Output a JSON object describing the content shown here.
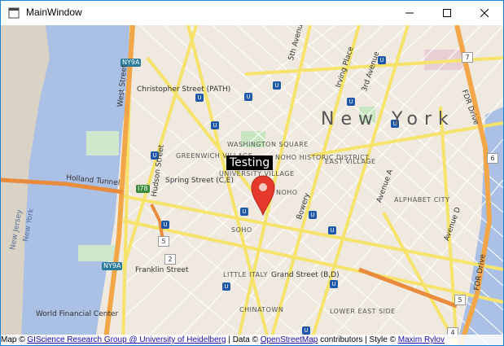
{
  "window": {
    "title": "MainWindow",
    "controls": {
      "minimize": "minimize",
      "maximize": "maximize",
      "close": "close"
    }
  },
  "map": {
    "marker_tooltip": "Testing",
    "city_label": "New York",
    "neighborhoods": {
      "washington_square": "WASHINGTON SQUARE",
      "greenwich_village": "GREENWICH VILLAGE",
      "university_village": "UNIVERSITY VILLAGE",
      "noho_historic": "NOHO HISTORIC DISTRICT",
      "noho": "NOHO",
      "east_village": "EAST VILLAGE",
      "alphabet_city": "ALPHABET CITY",
      "soho": "SOHO",
      "little_italy": "LITTLE ITALY",
      "chinatown": "CHINATOWN",
      "lower_east_side": "LOWER EAST SIDE",
      "world_financial_center": "World Financial Center"
    },
    "streets": {
      "west_street": "West Street",
      "fifth_avenue": "5th Avenue",
      "irving_place": "Irving Place",
      "third_avenue": "3rd Avenue",
      "fdr_drive_top": "FDR Drive",
      "fdr_drive_bottom": "FDR Drive",
      "holland_tunnel": "Holland Tunnel",
      "hudson_street": "Hudson Street",
      "spring_street": "Spring Street (C,E)",
      "christopher_street": "Christopher Street (PATH)",
      "avenue_a": "Avenue A",
      "avenue_d": "Avenue D",
      "bowery": "Bowery",
      "franklin_street": "Franklin Street",
      "grand_street": "Grand Street (B,D)",
      "new_jersey": "New Jersey",
      "new_york": "New York"
    },
    "shields": {
      "ny9a_top": "NY9A",
      "ny9a_bottom": "NY9A",
      "i78": "I78"
    },
    "routes": {
      "r7": "7",
      "r6": "6",
      "r5a": "5",
      "r2": "2",
      "r5b": "5",
      "r4": "4"
    },
    "subway_symbol": "U",
    "attribution": {
      "prefix": "Map ©",
      "gis_link": "GIScience Research Group @ University of Heidelberg",
      "data_text": "| Data ©",
      "osm_link": "OpenStreetMap",
      "style_text": "contributors | Style ©",
      "style_link": "Maxim Rylov"
    }
  }
}
